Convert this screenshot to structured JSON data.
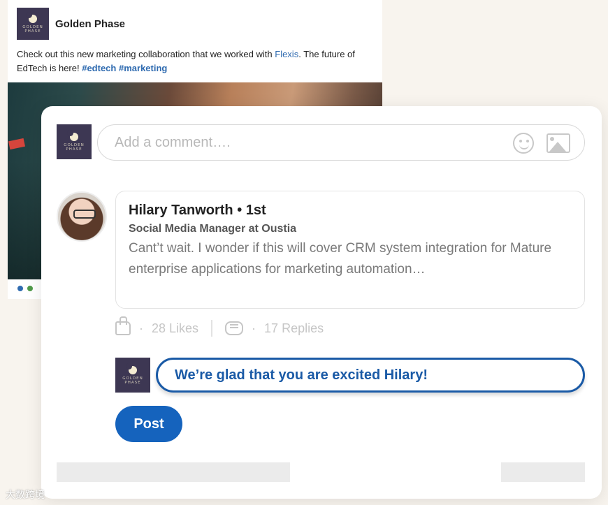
{
  "post": {
    "author": "Golden Phase",
    "logo_text_top": "GOLDEN",
    "logo_text_bottom": "PHASE",
    "text_before": "Check out this new marketing collaboration that we worked with ",
    "link": "Flexis",
    "text_after": ". The future of EdTech is here! ",
    "hashtag1": "#edtech",
    "hashtag2": "#marketing"
  },
  "comment_box": {
    "placeholder": "Add a comment….",
    "logo_text_top": "GOLDEN",
    "logo_text_bottom": "PHASE"
  },
  "reply": {
    "name": "Hilary Tanworth • 1st",
    "title": "Social  Media Manager at Oustia",
    "text": "Cant’t wait. I wonder if this will cover CRM system integration for Mature enterprise applications for marketing automation…"
  },
  "actions": {
    "likes": "28 Likes",
    "replies": "17 Replies",
    "separator": "·"
  },
  "my_reply": {
    "text": "We’re glad that you are excited Hilary!",
    "logo_text_top": "GOLDEN",
    "logo_text_bottom": "PHASE"
  },
  "post_button": "Post",
  "watermark": "大数跨境",
  "colors": {
    "accent": "#1563bd",
    "logo_bg": "#3d3753",
    "link": "#2f6bb0"
  }
}
